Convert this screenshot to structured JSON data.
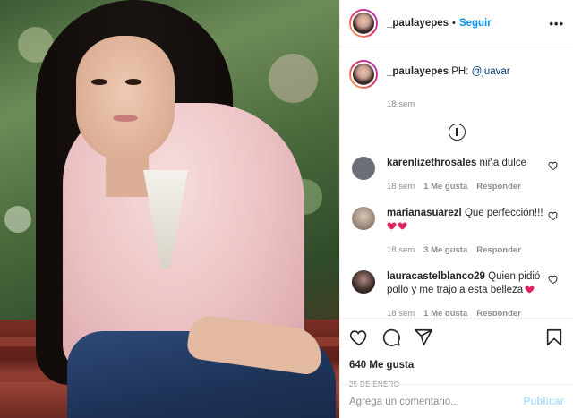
{
  "post": {
    "image_alt": "",
    "author": {
      "username": "_paulayepes",
      "separator": "•",
      "follow_label": "Seguir",
      "more_label": "•••"
    },
    "caption": {
      "username": "_paulayepes",
      "text": " PH: ",
      "mention": "@juavar",
      "time": "18 sem"
    },
    "comments": [
      {
        "username": "karenlizethrosales",
        "text": " niña dulce",
        "time": "18 sem",
        "likes": "1 Me gusta",
        "reply": "Responder",
        "avatar_color": "#6b6f77",
        "has_heart_emoji": false
      },
      {
        "username": "marianasuarezl",
        "text": " Que perfección!!! ",
        "time": "18 sem",
        "likes": "3 Me gusta",
        "reply": "Responder",
        "avatar_color": "#9a8a7c",
        "has_heart_emoji": true
      },
      {
        "username": "lauracastelblanco29",
        "text": " Quien pidió pollo y me trajo a esta belleza",
        "time": "18 sem",
        "likes": "1 Me gusta",
        "reply": "Responder",
        "avatar_color": "#3a2a28",
        "has_heart_emoji": true
      }
    ],
    "likes_count": "640 Me gusta",
    "date": "25 DE ENERO",
    "comment_input_placeholder": "Agrega un comentario...",
    "publish_label": "Publicar",
    "icons": {
      "like": "heart-icon",
      "comment": "comment-bubble-icon",
      "share": "paper-plane-icon",
      "save": "bookmark-icon",
      "load_more": "plus-circle-icon"
    },
    "colors": {
      "follow": "#0095f6",
      "publish_disabled": "#b2dffc",
      "heart_emoji": "#e0245e",
      "meta": "#8e8e8e"
    }
  }
}
